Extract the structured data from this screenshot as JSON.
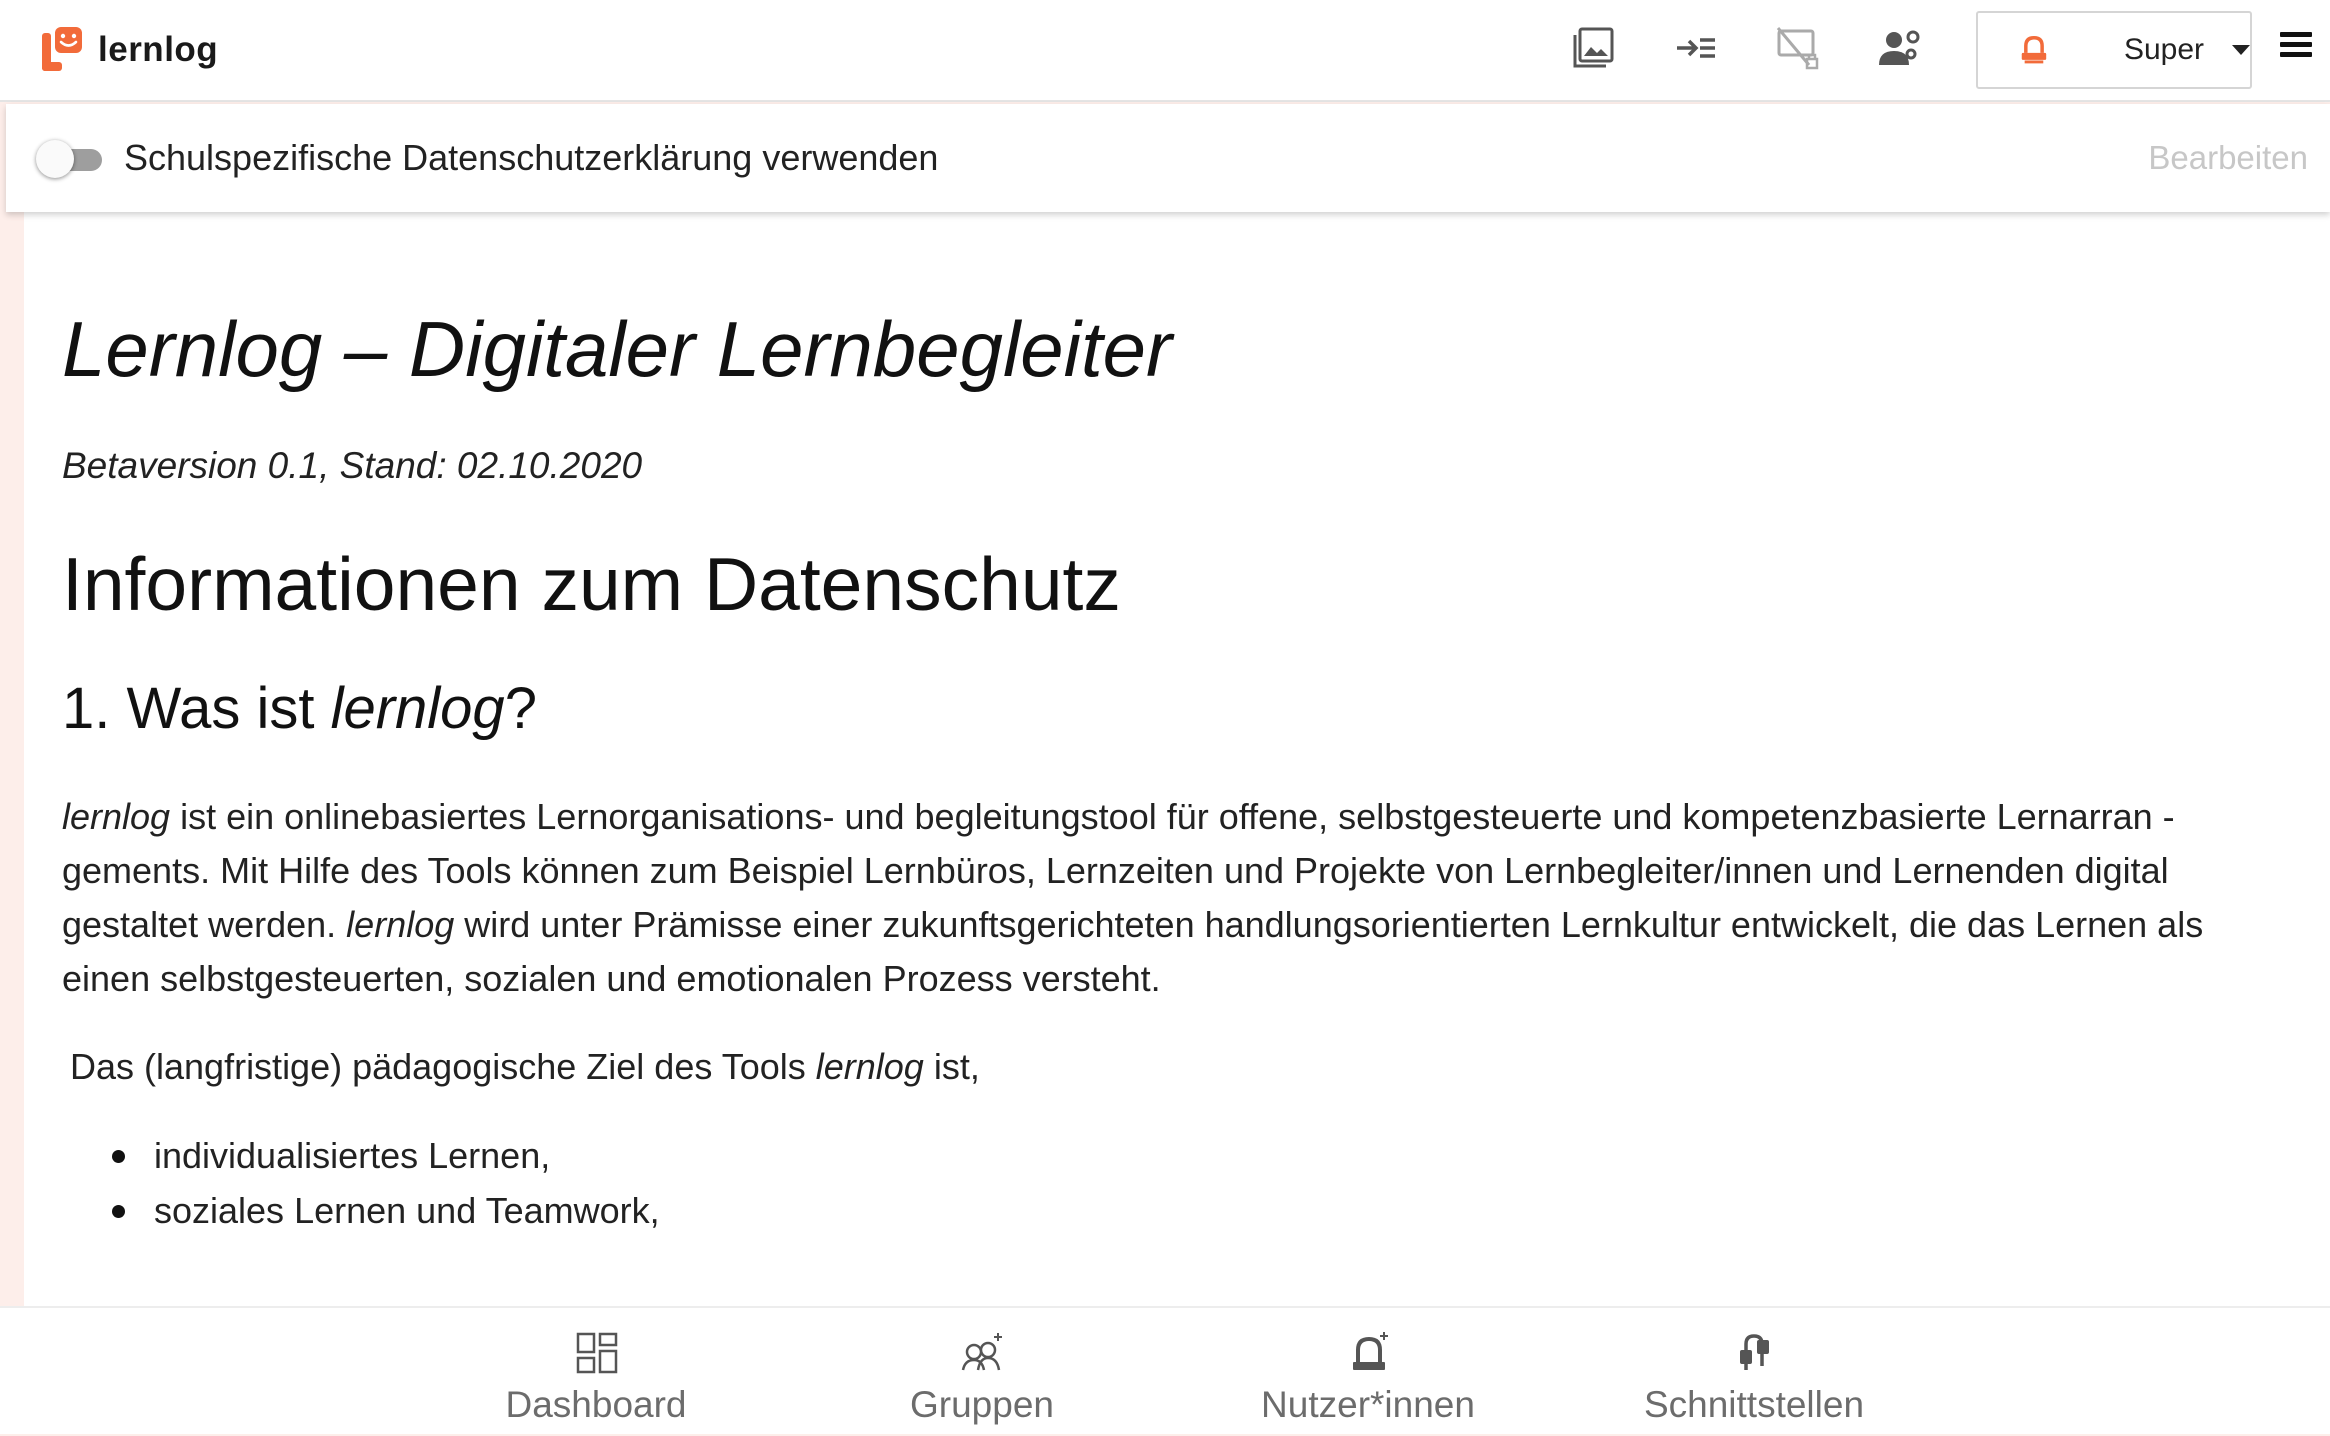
{
  "header": {
    "brand_name": "lernlog",
    "toolbar": [
      {
        "icon": "image-gallery-icon"
      },
      {
        "icon": "indent-icon"
      },
      {
        "icon": "screen-disabled-icon"
      },
      {
        "icon": "user-settings-icon"
      }
    ],
    "user": {
      "name": "Super",
      "avatar_icon": "user-avatar-icon",
      "accent_color": "#f26b3a"
    },
    "menu_icon": "hamburger-menu-icon"
  },
  "settings": {
    "toggle_label": "Schulspezifische Datenschutzerklärung verwenden",
    "toggle_state": "off",
    "edit_label": "Bearbeiten"
  },
  "content": {
    "title": "Lernlog – Digitaler Lernbegleiter",
    "version": "Betaversion 0.1, Stand: 02.10.2020",
    "heading": "Informationen zum Datenschutz",
    "section1": {
      "number": "1. Was ist ",
      "term": "lernlog",
      "suffix": "?"
    },
    "paragraph": {
      "term1": "lernlog",
      "text1": " ist ein onlinebasiertes Lernorganisations- und begleitungstool für offene, selbstgesteuerte und kompetenzbasierte Lernarran - gements. Mit Hilfe des Tools können zum Beispiel Lernbüros, Lernzeiten und Projekte von Lernbegleiter/innen und Lernenden digital gestaltet werden. ",
      "term2": "lernlog",
      "text2": " wird unter Prämisse einer zukunftsgerichteten handlungsorientierten Lernkultur entwickelt, die das Lernen als einen selbstgesteuerten, sozialen und emotionalen Prozess versteht."
    },
    "goal": {
      "prefix": "Das (langfristige) pädagogische Ziel des Tools ",
      "term": "lernlog",
      "suffix": " ist,"
    },
    "goals_list": [
      "individualisiertes Lernen,",
      "soziales Lernen und Teamwork,"
    ]
  },
  "bottom_nav": [
    {
      "label": "Dashboard",
      "icon": "dashboard-icon"
    },
    {
      "label": "Gruppen",
      "icon": "groups-add-icon"
    },
    {
      "label": "Nutzer*innen",
      "icon": "user-add-icon"
    },
    {
      "label": "Schnittstellen",
      "icon": "interfaces-icon"
    }
  ],
  "colors": {
    "accent": "#f26b3a",
    "background_tint": "#fdeeea",
    "muted_text": "#c7c7c7"
  }
}
